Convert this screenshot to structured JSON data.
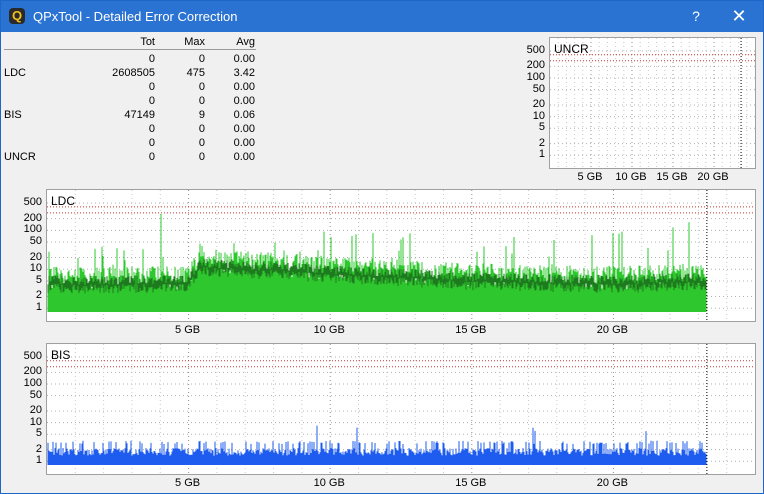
{
  "window": {
    "title": "QPxTool - Detailed Error Correction",
    "help_label": "?",
    "close_label": "✕",
    "app_icon": "qpxtool-icon"
  },
  "stats": {
    "headers": [
      "Tot",
      "Max",
      "Avg"
    ],
    "rows": [
      {
        "label": "",
        "tot": "0",
        "max": "0",
        "avg": "0.00"
      },
      {
        "label": "LDC",
        "tot": "2608505",
        "max": "475",
        "avg": "3.42"
      },
      {
        "label": "",
        "tot": "0",
        "max": "0",
        "avg": "0.00"
      },
      {
        "label": "",
        "tot": "0",
        "max": "0",
        "avg": "0.00"
      },
      {
        "label": "BIS",
        "tot": "47149",
        "max": "9",
        "avg": "0.06"
      },
      {
        "label": "",
        "tot": "0",
        "max": "0",
        "avg": "0.00"
      },
      {
        "label": "",
        "tot": "0",
        "max": "0",
        "avg": "0.00"
      },
      {
        "label": "UNCR",
        "tot": "0",
        "max": "0",
        "avg": "0.00"
      }
    ]
  },
  "colors": {
    "ldc_light": "#2ec82e",
    "ldc_dark": "#1e7a1e",
    "bis": "#1e5cf0",
    "limit": "#c83232",
    "titlebar": "#2b73d2"
  },
  "chart_data": [
    {
      "type": "bar",
      "title": "UNCR",
      "x_ticks": [
        "5 GB",
        "10 GB",
        "15 GB",
        "20 GB"
      ],
      "y_ticks": [
        "500",
        "200",
        "100",
        "50",
        "20",
        "10",
        "5",
        "2",
        "1"
      ],
      "y_scale": "log",
      "x_range_gb": [
        0,
        25
      ],
      "values": []
    },
    {
      "type": "bar",
      "title": "LDC",
      "x_ticks": [
        "5 GB",
        "10 GB",
        "15 GB",
        "20 GB"
      ],
      "y_ticks": [
        "500",
        "200",
        "100",
        "50",
        "20",
        "10",
        "5",
        "2",
        "1"
      ],
      "y_scale": "log",
      "x_range_gb": [
        0,
        25
      ],
      "data_end_gb": 23.3,
      "max": 475,
      "avg": 3.42,
      "profile": [
        {
          "gb": 0,
          "typ": 5,
          "peak": 30
        },
        {
          "gb": 5,
          "typ": 5,
          "peak": 40
        },
        {
          "gb": 5.5,
          "typ": 14,
          "peak": 60
        },
        {
          "gb": 10,
          "typ": 9,
          "peak": 100
        },
        {
          "gb": 15,
          "typ": 6,
          "peak": 60
        },
        {
          "gb": 20,
          "typ": 5,
          "peak": 80
        },
        {
          "gb": 23.3,
          "typ": 6,
          "peak": 200
        }
      ]
    },
    {
      "type": "bar",
      "title": "BIS",
      "x_ticks": [
        "5 GB",
        "10 GB",
        "15 GB",
        "20 GB"
      ],
      "y_ticks": [
        "500",
        "200",
        "100",
        "50",
        "20",
        "10",
        "5",
        "2",
        "1"
      ],
      "y_scale": "log",
      "x_range_gb": [
        0,
        25
      ],
      "data_end_gb": 23.3,
      "max": 9,
      "avg": 0.06,
      "typical": 2
    }
  ]
}
